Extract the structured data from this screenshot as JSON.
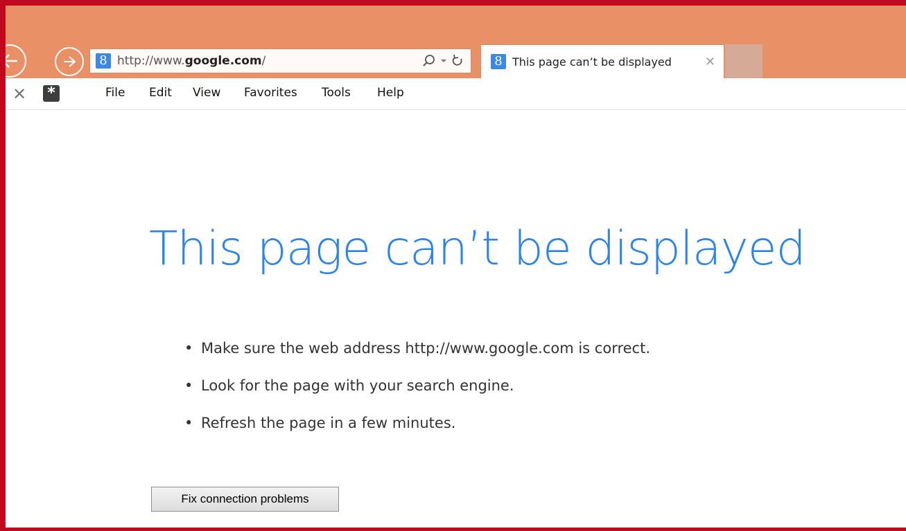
{
  "browser": {
    "address_bar": {
      "url_prefix": "http://www.",
      "url_domain": "google.com",
      "url_suffix": "/",
      "site_icon": "google-g-icon"
    },
    "tab": {
      "title": "This page can’t be displayed",
      "close_glyph": "✕",
      "site_icon": "google-g-icon"
    },
    "menubar": {
      "close_glyph": "✕",
      "extension_icon": "asterisk-icon",
      "items": [
        "File",
        "Edit",
        "View",
        "Favorites",
        "Tools",
        "Help"
      ]
    }
  },
  "page": {
    "headline": "This page can’t be displayed",
    "tips": [
      "Make sure the web address http://www.google.com is correct.",
      "Look for the page with your search engine.",
      "Refresh the page in a few minutes."
    ],
    "bullet": "•",
    "fix_button_label": "Fix connection problems"
  },
  "colors": {
    "frame_border": "#c0081f",
    "titlebar": "#ea9066",
    "headline": "#2c84e8",
    "site_icon_bg": "#3b88e6"
  }
}
